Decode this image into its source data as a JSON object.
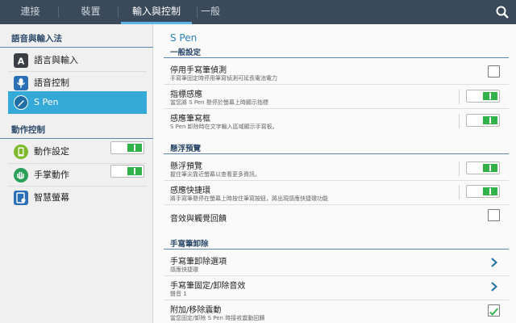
{
  "tabs": [
    {
      "label": "連接",
      "active": false
    },
    {
      "label": "裝置",
      "active": false
    },
    {
      "label": "輸入與控制",
      "active": true
    },
    {
      "label": "一般",
      "active": false
    }
  ],
  "left": {
    "section1_header": "語音與輸入法",
    "section2_header": "動作控制",
    "items": [
      {
        "label": "語言與輸入",
        "icon": "keyboard-a-icon",
        "toggle": null,
        "selected": false
      },
      {
        "label": "語音控制",
        "icon": "microphone-icon",
        "toggle": "off",
        "selected": false
      },
      {
        "label": "S Pen",
        "icon": "spen-icon",
        "toggle": null,
        "selected": true
      },
      {
        "label": "動作設定",
        "icon": "motion-icon",
        "toggle": "on",
        "selected": false
      },
      {
        "label": "手掌動作",
        "icon": "palm-motion-icon",
        "toggle": "on",
        "selected": false
      },
      {
        "label": "智慧螢幕",
        "icon": "smart-screen-icon",
        "toggle": null,
        "selected": false
      }
    ]
  },
  "right": {
    "title": "S Pen",
    "sections": [
      {
        "header": "一般設定"
      },
      {
        "header": "懸浮預覽"
      },
      {
        "header": "手寫筆卸除"
      }
    ],
    "items": [
      {
        "title": "停用手寫筆偵測",
        "sub": "手寫筆固定時停用筆寫偵測可延長電池電力",
        "control": "checkbox",
        "checked": false
      },
      {
        "title": "指標感應",
        "sub": "當您將 S Pen 懸停於螢幕上時顯示指標",
        "control": "toggle",
        "on": true
      },
      {
        "title": "感應筆寫框",
        "sub": "S Pen 卸除時在文字輸入區域顯示手寫板。",
        "control": "toggle",
        "on": true
      },
      {
        "title": "懸浮預覽",
        "sub": "握住筆尖靠近螢幕以查看更多資訊。",
        "control": "toggle",
        "on": true
      },
      {
        "title": "感應快捷環",
        "sub": "將手寫筆懸停在螢幕上時按住筆寫按鈕，將出現感應快捷環功能",
        "control": "toggle",
        "on": true
      },
      {
        "title": "音效與觸覺回饋",
        "sub": "",
        "control": "checkbox",
        "checked": false
      },
      {
        "title": "手寫筆卸除選項",
        "sub": "感應快捷環",
        "control": "chevron"
      },
      {
        "title": "手寫筆固定/卸除音效",
        "sub": "聲音 1",
        "control": "chevron"
      },
      {
        "title": "附加/移除震動",
        "sub": "當您固定/卸除 S Pen 時接收震動回饋",
        "control": "checkbox",
        "checked": true
      }
    ]
  },
  "colors": {
    "accent": "#35a9d8",
    "topbar": "#3a4a5a",
    "toggle_on": "#31b34a",
    "header_text": "#2c4a6b"
  }
}
